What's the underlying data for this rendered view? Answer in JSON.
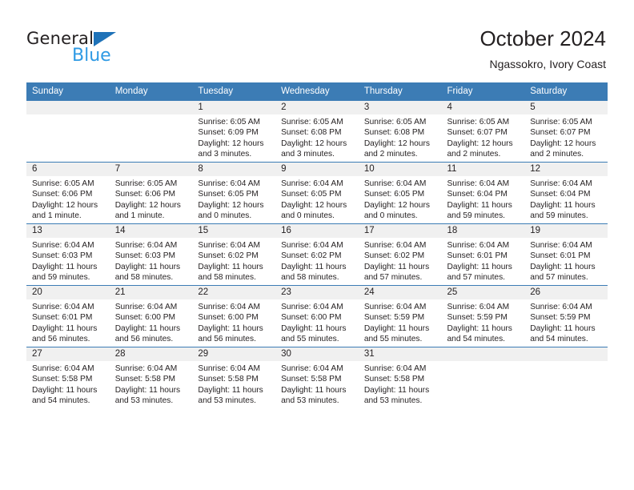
{
  "brand": {
    "name_top": "General",
    "name_bottom": "Blue",
    "triangle_icon": "triangle-icon",
    "color_dark": "#231f20",
    "color_blue": "#2e9ae4",
    "color_triangle": "#1e72b8"
  },
  "header": {
    "title": "October 2024",
    "subtitle": "Ngassokro, Ivory Coast"
  },
  "theme": {
    "header_bg": "#3c7cb5",
    "header_text": "#ffffff",
    "daynum_bg": "#f0f0f0",
    "cell_bg": "#ffffff",
    "row_border": "#3c7cb5"
  },
  "weekdays": [
    "Sunday",
    "Monday",
    "Tuesday",
    "Wednesday",
    "Thursday",
    "Friday",
    "Saturday"
  ],
  "labels": {
    "sunrise": "Sunrise:",
    "sunset": "Sunset:",
    "daylight": "Daylight:"
  },
  "weeks": [
    [
      {
        "day": "",
        "sunrise": "",
        "sunset": "",
        "daylight": "",
        "empty": true
      },
      {
        "day": "",
        "sunrise": "",
        "sunset": "",
        "daylight": "",
        "empty": true
      },
      {
        "day": "1",
        "sunrise": "Sunrise: 6:05 AM",
        "sunset": "Sunset: 6:09 PM",
        "daylight": "Daylight: 12 hours and 3 minutes."
      },
      {
        "day": "2",
        "sunrise": "Sunrise: 6:05 AM",
        "sunset": "Sunset: 6:08 PM",
        "daylight": "Daylight: 12 hours and 3 minutes."
      },
      {
        "day": "3",
        "sunrise": "Sunrise: 6:05 AM",
        "sunset": "Sunset: 6:08 PM",
        "daylight": "Daylight: 12 hours and 2 minutes."
      },
      {
        "day": "4",
        "sunrise": "Sunrise: 6:05 AM",
        "sunset": "Sunset: 6:07 PM",
        "daylight": "Daylight: 12 hours and 2 minutes."
      },
      {
        "day": "5",
        "sunrise": "Sunrise: 6:05 AM",
        "sunset": "Sunset: 6:07 PM",
        "daylight": "Daylight: 12 hours and 2 minutes."
      }
    ],
    [
      {
        "day": "6",
        "sunrise": "Sunrise: 6:05 AM",
        "sunset": "Sunset: 6:06 PM",
        "daylight": "Daylight: 12 hours and 1 minute."
      },
      {
        "day": "7",
        "sunrise": "Sunrise: 6:05 AM",
        "sunset": "Sunset: 6:06 PM",
        "daylight": "Daylight: 12 hours and 1 minute."
      },
      {
        "day": "8",
        "sunrise": "Sunrise: 6:04 AM",
        "sunset": "Sunset: 6:05 PM",
        "daylight": "Daylight: 12 hours and 0 minutes."
      },
      {
        "day": "9",
        "sunrise": "Sunrise: 6:04 AM",
        "sunset": "Sunset: 6:05 PM",
        "daylight": "Daylight: 12 hours and 0 minutes."
      },
      {
        "day": "10",
        "sunrise": "Sunrise: 6:04 AM",
        "sunset": "Sunset: 6:05 PM",
        "daylight": "Daylight: 12 hours and 0 minutes."
      },
      {
        "day": "11",
        "sunrise": "Sunrise: 6:04 AM",
        "sunset": "Sunset: 6:04 PM",
        "daylight": "Daylight: 11 hours and 59 minutes."
      },
      {
        "day": "12",
        "sunrise": "Sunrise: 6:04 AM",
        "sunset": "Sunset: 6:04 PM",
        "daylight": "Daylight: 11 hours and 59 minutes."
      }
    ],
    [
      {
        "day": "13",
        "sunrise": "Sunrise: 6:04 AM",
        "sunset": "Sunset: 6:03 PM",
        "daylight": "Daylight: 11 hours and 59 minutes."
      },
      {
        "day": "14",
        "sunrise": "Sunrise: 6:04 AM",
        "sunset": "Sunset: 6:03 PM",
        "daylight": "Daylight: 11 hours and 58 minutes."
      },
      {
        "day": "15",
        "sunrise": "Sunrise: 6:04 AM",
        "sunset": "Sunset: 6:02 PM",
        "daylight": "Daylight: 11 hours and 58 minutes."
      },
      {
        "day": "16",
        "sunrise": "Sunrise: 6:04 AM",
        "sunset": "Sunset: 6:02 PM",
        "daylight": "Daylight: 11 hours and 58 minutes."
      },
      {
        "day": "17",
        "sunrise": "Sunrise: 6:04 AM",
        "sunset": "Sunset: 6:02 PM",
        "daylight": "Daylight: 11 hours and 57 minutes."
      },
      {
        "day": "18",
        "sunrise": "Sunrise: 6:04 AM",
        "sunset": "Sunset: 6:01 PM",
        "daylight": "Daylight: 11 hours and 57 minutes."
      },
      {
        "day": "19",
        "sunrise": "Sunrise: 6:04 AM",
        "sunset": "Sunset: 6:01 PM",
        "daylight": "Daylight: 11 hours and 57 minutes."
      }
    ],
    [
      {
        "day": "20",
        "sunrise": "Sunrise: 6:04 AM",
        "sunset": "Sunset: 6:01 PM",
        "daylight": "Daylight: 11 hours and 56 minutes."
      },
      {
        "day": "21",
        "sunrise": "Sunrise: 6:04 AM",
        "sunset": "Sunset: 6:00 PM",
        "daylight": "Daylight: 11 hours and 56 minutes."
      },
      {
        "day": "22",
        "sunrise": "Sunrise: 6:04 AM",
        "sunset": "Sunset: 6:00 PM",
        "daylight": "Daylight: 11 hours and 56 minutes."
      },
      {
        "day": "23",
        "sunrise": "Sunrise: 6:04 AM",
        "sunset": "Sunset: 6:00 PM",
        "daylight": "Daylight: 11 hours and 55 minutes."
      },
      {
        "day": "24",
        "sunrise": "Sunrise: 6:04 AM",
        "sunset": "Sunset: 5:59 PM",
        "daylight": "Daylight: 11 hours and 55 minutes."
      },
      {
        "day": "25",
        "sunrise": "Sunrise: 6:04 AM",
        "sunset": "Sunset: 5:59 PM",
        "daylight": "Daylight: 11 hours and 54 minutes."
      },
      {
        "day": "26",
        "sunrise": "Sunrise: 6:04 AM",
        "sunset": "Sunset: 5:59 PM",
        "daylight": "Daylight: 11 hours and 54 minutes."
      }
    ],
    [
      {
        "day": "27",
        "sunrise": "Sunrise: 6:04 AM",
        "sunset": "Sunset: 5:58 PM",
        "daylight": "Daylight: 11 hours and 54 minutes."
      },
      {
        "day": "28",
        "sunrise": "Sunrise: 6:04 AM",
        "sunset": "Sunset: 5:58 PM",
        "daylight": "Daylight: 11 hours and 53 minutes."
      },
      {
        "day": "29",
        "sunrise": "Sunrise: 6:04 AM",
        "sunset": "Sunset: 5:58 PM",
        "daylight": "Daylight: 11 hours and 53 minutes."
      },
      {
        "day": "30",
        "sunrise": "Sunrise: 6:04 AM",
        "sunset": "Sunset: 5:58 PM",
        "daylight": "Daylight: 11 hours and 53 minutes."
      },
      {
        "day": "31",
        "sunrise": "Sunrise: 6:04 AM",
        "sunset": "Sunset: 5:58 PM",
        "daylight": "Daylight: 11 hours and 53 minutes."
      },
      {
        "day": "",
        "sunrise": "",
        "sunset": "",
        "daylight": "",
        "empty": true
      },
      {
        "day": "",
        "sunrise": "",
        "sunset": "",
        "daylight": "",
        "empty": true
      }
    ]
  ]
}
